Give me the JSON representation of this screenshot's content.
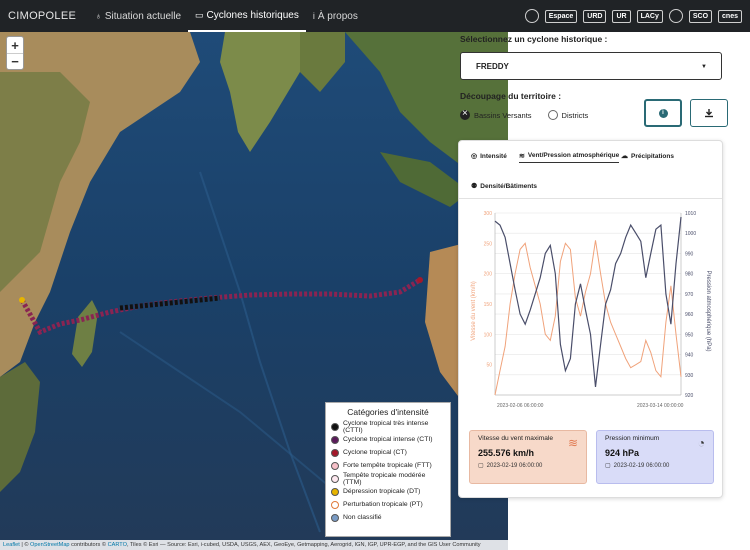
{
  "navbar": {
    "brand": "CIMOPOLEE",
    "items": [
      {
        "label": "Situation actuelle",
        "icon": "♁",
        "active": false
      },
      {
        "label": "Cyclones historiques",
        "icon": "▭",
        "active": true
      },
      {
        "label": "À propos",
        "icon": "i",
        "active": false
      }
    ],
    "logos": [
      "Espace",
      "URD",
      "UR",
      "LACy",
      "SCO",
      "cnes"
    ]
  },
  "map": {
    "zoom_in": "+",
    "zoom_out": "−",
    "legend_title": "Catégories d'intensité",
    "legend_items": [
      {
        "label": "Cyclone tropical très intense (CTTI)",
        "color": "#111111"
      },
      {
        "label": "Cyclone tropical intense (CTI)",
        "color": "#5a1a5a"
      },
      {
        "label": "Cyclone tropical (CT)",
        "color": "#a3182a"
      },
      {
        "label": "Forte tempête tropicale (FTT)",
        "color": "#f6c0c8"
      },
      {
        "label": "Tempête tropicale modérée (TTM)",
        "color": "#fde8ef"
      },
      {
        "label": "Dépression tropicale (DT)",
        "color": "#e6b400"
      },
      {
        "label": "Perturbation tropicale (PT)",
        "color": "#ffffff"
      },
      {
        "label": "Non classifié",
        "color": "#7a9bc4"
      }
    ],
    "attribution": {
      "leaflet": "Leaflet",
      "sep1": " | © ",
      "osm": "OpenStreetMap",
      "mid": " contributors © ",
      "carto": "CARTO",
      "rest": ", Tiles © Esri — Source: Esri, i-cubed, USDA, USGS, AEX, GeoEye, Getmapping, Aerogrid, IGN, IGP, UPR-EGP, and the GIS User Community"
    }
  },
  "panel": {
    "select_label": "Sélectionnez un cyclone historique :",
    "selected_cyclone": "FREDDY",
    "decoupage_label": "Découpage du territoire :",
    "radio_options": [
      {
        "label": "Bassins Versants",
        "checked": true
      },
      {
        "label": "Districts",
        "checked": false
      }
    ],
    "tabs": [
      {
        "label": "Intensité",
        "icon": "◎"
      },
      {
        "label": "Vent/Pression atmosphérique",
        "icon": "≋"
      },
      {
        "label": "Précipitations",
        "icon": "☁"
      },
      {
        "label": "Densité/Bâtiments",
        "icon": "⚉"
      }
    ],
    "wind_card": {
      "label": "Vitesse du vent maximale",
      "value": "255.576 km/h",
      "date": "2023-02-19 06:00:00"
    },
    "pressure_card": {
      "label": "Pression minimum",
      "value": "924 hPa",
      "date": "2023-02-19 06:00:00"
    }
  },
  "chart_data": {
    "type": "line",
    "x_start": "2023-02-06 06:00:00",
    "x_end": "2023-03-14 00:00:00",
    "ylabel_left": "Vitesse du vent (km/h)",
    "ylabel_right": "Pression atmosphérique (hPa)",
    "ylim_left": [
      0,
      300
    ],
    "ylim_right": [
      920,
      1010
    ],
    "left_ticks": [
      50,
      100,
      150,
      200,
      250,
      300
    ],
    "right_ticks": [
      920,
      930,
      940,
      950,
      960,
      970,
      980,
      990,
      1000,
      1010
    ],
    "grid": true,
    "series": [
      {
        "name": "Vitesse du vent",
        "axis": "left",
        "color": "#f0a27a",
        "values": [
          0,
          40,
          80,
          150,
          200,
          240,
          250,
          210,
          180,
          150,
          100,
          90,
          130,
          220,
          250,
          240,
          160,
          130,
          170,
          200,
          255,
          200,
          150,
          120,
          100,
          80,
          60,
          45,
          50,
          55,
          90,
          70,
          40,
          30,
          120,
          180,
          100,
          30
        ]
      },
      {
        "name": "Pression atmosphérique",
        "axis": "right",
        "color": "#4a4e6a",
        "values": [
          1006,
          1004,
          998,
          985,
          972,
          960,
          955,
          962,
          970,
          978,
          990,
          994,
          980,
          945,
          932,
          938,
          965,
          975,
          962,
          950,
          924,
          945,
          965,
          972,
          985,
          990,
          998,
          1004,
          1000,
          996,
          978,
          990,
          1002,
          1004,
          970,
          955,
          985,
          1008
        ]
      }
    ]
  }
}
